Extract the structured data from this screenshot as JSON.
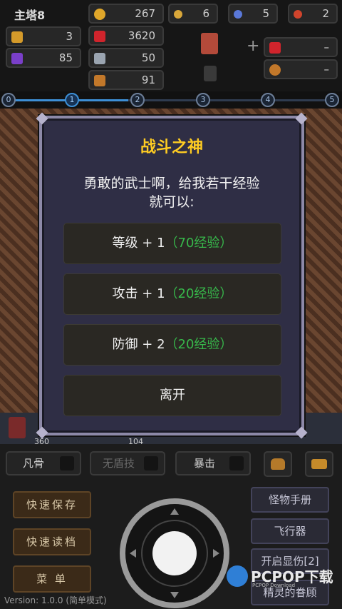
{
  "hud": {
    "floor": "主塔8",
    "level": "3",
    "gem": "85",
    "gold": "267",
    "hp": "3620",
    "attack": "50",
    "defense": "91",
    "key_yellow": "6",
    "key_blue": "5",
    "key_red": "2",
    "bonus_hp": "–",
    "bonus_def": "–",
    "plus_sign": "+"
  },
  "progress": {
    "nodes": [
      "0",
      "1",
      "2",
      "3",
      "4",
      "5"
    ],
    "active": 1
  },
  "map": {
    "tile_left_num": "360",
    "tile_mid_num": "104"
  },
  "modal": {
    "title": "战斗之神",
    "message_line1": "勇敢的武士啊，给我若干经验",
    "message_line2": "就可以:",
    "options": [
      {
        "label": "等级 + 1",
        "cost": "（70经验）"
      },
      {
        "label": "攻击 + 1",
        "cost": "（20经验）"
      },
      {
        "label": "防御 + 2",
        "cost": "（20经验）"
      },
      {
        "label": "离开",
        "cost": ""
      }
    ]
  },
  "skills": {
    "fan_gu": "凡骨",
    "wu_dun_ji": "无盾技",
    "bao_ji": "暴击"
  },
  "left_buttons": {
    "quick_save": "快速保存",
    "quick_load": "快速读档",
    "menu": "菜 单"
  },
  "right_buttons": {
    "monster_book": "怪物手册",
    "fly": "飞行器",
    "show_damage": "开启显伤[2]",
    "fairy": "精灵的眷顾"
  },
  "version": "Version: 1.0.0 (简单模式)",
  "watermark": {
    "brand": "PCPOP下载",
    "sub": "PCPOP Download"
  },
  "colors": {
    "title": "#ffcc22",
    "cost": "#37b84b",
    "accent": "#3d8fd6"
  }
}
